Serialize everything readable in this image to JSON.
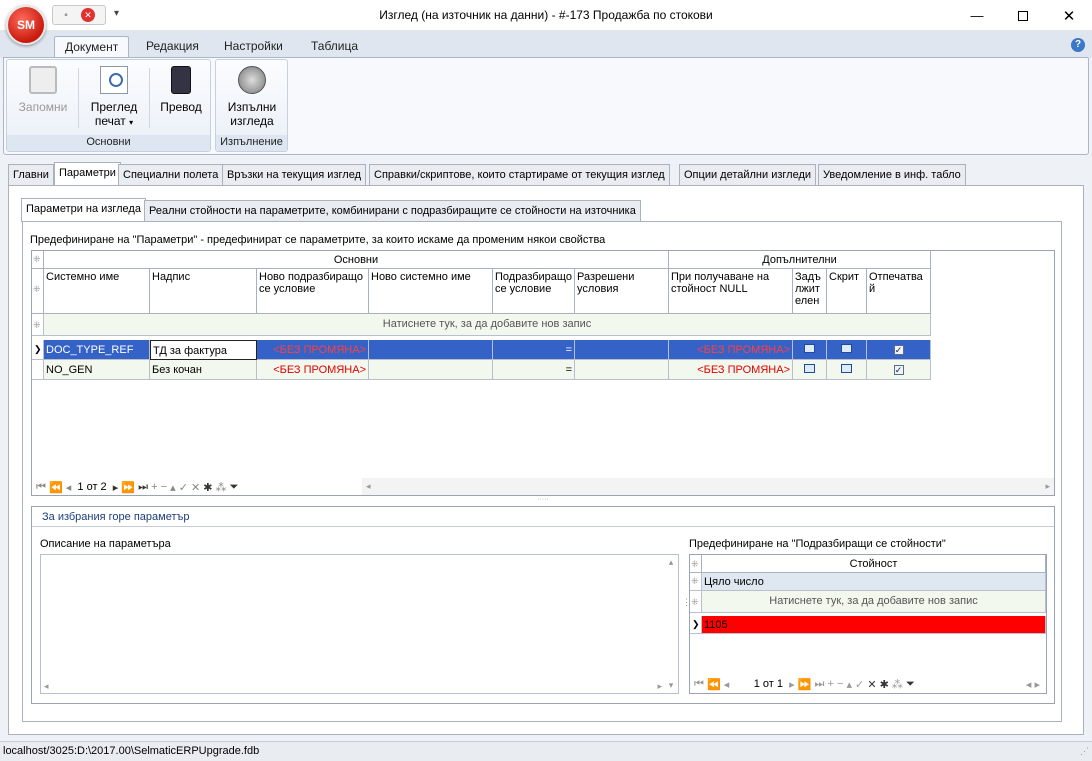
{
  "window": {
    "title": "Изглед (на източник на данни) - #-173 Продажба по стокови",
    "logo_text": "SM"
  },
  "ribbon": {
    "tabs": [
      "Документ",
      "Редакция",
      "Настройки",
      "Таблица"
    ],
    "groups": {
      "main_caption": "Основни",
      "exec_caption": "Изпълнение"
    },
    "buttons": {
      "save": "Запомни",
      "preview_line1": "Преглед",
      "preview_line2": "печат",
      "translate": "Превод",
      "execute_line1": "Изпълни",
      "execute_line2": "изгледа"
    }
  },
  "main_tabs": [
    "Главни",
    "Параметри",
    "Специални полета",
    "Връзки на текущия изглед",
    "Справки/скриптове, които стартираме от текущия изглед",
    "Опции детайлни изгледи",
    "Уведомление в инф. табло"
  ],
  "sub_tabs": [
    "Параметри на изгледа",
    "Реални стойности на параметрите, комбинирани с подразбиращите се стойности на източника"
  ],
  "section_caption": "Предефиниране на \"Параметри\" - предефинират се параметрите, за които искаме да променим някои свойства",
  "grid": {
    "bands": {
      "basic": "Основни",
      "extra": "Допълнителни"
    },
    "columns": {
      "system_name": "Системно име",
      "caption": "Надпис",
      "new_default_cond": "Ново подразбиращо се условие",
      "new_system_name": "Ново системно име",
      "default_cond": "Подразбиращо се условие",
      "allowed_cond": "Разрешени условия",
      "on_null": "При получаване на стойност NULL",
      "required": "Задължителен",
      "hidden": "Скрит",
      "printed": "Отпечатвай"
    },
    "add_row_text": "Натиснете тук, за да добавите нов запис",
    "rows": [
      {
        "system_name": "DOC_TYPE_REF",
        "caption": "ТД за фактура",
        "new_default_cond": "<БЕЗ ПРОМЯНА>",
        "default_cond": "=",
        "on_null": "<БЕЗ ПРОМЯНА>",
        "printed": "✓"
      },
      {
        "system_name": "NO_GEN",
        "caption": "Без кочан",
        "new_default_cond": "<БЕЗ ПРОМЯНА>",
        "default_cond": "=",
        "on_null": "<БЕЗ ПРОМЯНА>",
        "printed": "✓"
      }
    ],
    "nav_text": "1 от 2"
  },
  "lower": {
    "caption": "За избрания горе параметър",
    "description_label": "Описание на параметъра",
    "defaults_label": "Предефиниране на \"Подразбиращи се стойности\"",
    "value_header": "Стойност",
    "group_row": "Цяло число",
    "add_row_text": "Натиснете тук, за да добавите нов запис",
    "value_row": "1105",
    "nav_text": "1 от 1"
  },
  "status": {
    "path": "localhost/3025:D:\\2017.00\\SelmaticERPUpgrade.fdb"
  },
  "colors": {
    "selected_row": "#3562c7",
    "red_row": "#ff0000",
    "red_text": "#e00000"
  }
}
